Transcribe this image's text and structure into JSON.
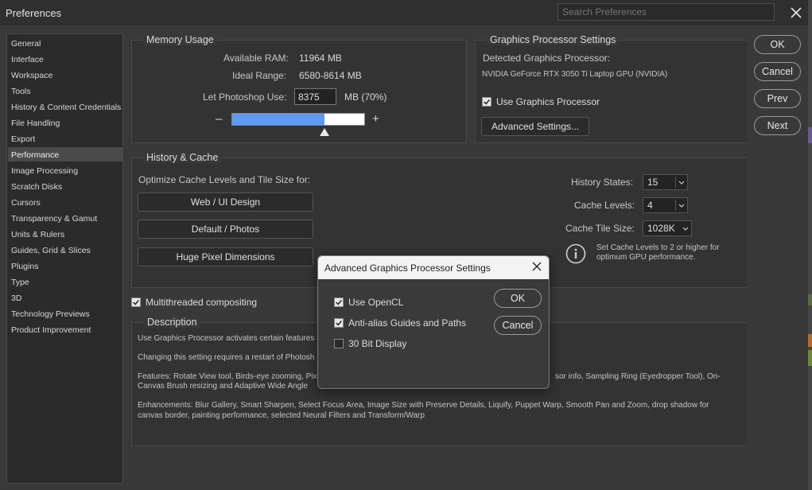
{
  "window": {
    "title": "Preferences",
    "search_placeholder": "Search Preferences"
  },
  "sidebar": {
    "items": [
      {
        "label": "General"
      },
      {
        "label": "Interface"
      },
      {
        "label": "Workspace"
      },
      {
        "label": "Tools"
      },
      {
        "label": "History & Content Credentials"
      },
      {
        "label": "File Handling"
      },
      {
        "label": "Export"
      },
      {
        "label": "Performance",
        "active": true
      },
      {
        "label": "Image Processing"
      },
      {
        "label": "Scratch Disks"
      },
      {
        "label": "Cursors"
      },
      {
        "label": "Transparency & Gamut"
      },
      {
        "label": "Units & Rulers"
      },
      {
        "label": "Guides, Grid & Slices"
      },
      {
        "label": "Plugins"
      },
      {
        "label": "Type"
      },
      {
        "label": "3D"
      },
      {
        "label": "Technology Previews"
      },
      {
        "label": "Product Improvement"
      }
    ]
  },
  "actions": {
    "ok": "OK",
    "cancel": "Cancel",
    "prev": "Prev",
    "next": "Next"
  },
  "memory": {
    "title": "Memory Usage",
    "available_label": "Available RAM:",
    "available_value": "11964 MB",
    "ideal_label": "Ideal Range:",
    "ideal_value": "6580-8614 MB",
    "use_label": "Let Photoshop Use:",
    "use_value": "8375",
    "use_unit": "MB (70%)",
    "minus": "–",
    "plus": "+",
    "slider_fraction": 0.7
  },
  "gpu": {
    "title": "Graphics Processor Settings",
    "detected_label": "Detected Graphics Processor:",
    "detected_value": "NVIDIA GeForce RTX 3050 Ti Laptop GPU (NVIDIA)",
    "use_gpu_label": "Use Graphics Processor",
    "use_gpu_checked": true,
    "advanced_button": "Advanced Settings..."
  },
  "history_cache": {
    "title": "History & Cache",
    "optimize_label": "Optimize Cache Levels and Tile Size for:",
    "buttons": [
      "Web / UI Design",
      "Default / Photos",
      "Huge Pixel Dimensions"
    ],
    "history_states_label": "History States:",
    "history_states_value": "15",
    "cache_levels_label": "Cache Levels:",
    "cache_levels_value": "4",
    "tile_size_label": "Cache Tile Size:",
    "tile_size_value": "1028K",
    "info_line1": "Set Cache Levels to 2 or higher for",
    "info_line2": "optimum GPU performance."
  },
  "multithreaded": {
    "label": "Multithreaded compositing",
    "checked": true
  },
  "description": {
    "title": "Description",
    "line1": "Use Graphics Processor activates certain features a",
    "line2": "Changing this setting requires a restart of Photosh",
    "line3a": "Features: Rotate View tool, Birds-eye zooming, Pixe",
    "line3b": "sor info, Sampling Ring (Eyedropper Tool), On-",
    "line4": "Canvas Brush resizing and Adaptive Wide Angle",
    "line5": "Enhancements: Blur Gallery, Smart Sharpen, Select Focus Area, Image Size with Preserve Details, Liquify, Puppet Warp, Smooth Pan and Zoom, drop shadow for",
    "line6": "canvas border, painting performance, selected Neural Filters and Transform/Warp"
  },
  "dialog": {
    "title": "Advanced Graphics Processor Settings",
    "options": [
      {
        "label": "Use OpenCL",
        "checked": true
      },
      {
        "label": "Anti-alias Guides and Paths",
        "checked": true
      },
      {
        "label": "30 Bit Display",
        "checked": false
      }
    ],
    "ok": "OK",
    "cancel": "Cancel"
  },
  "colors": {
    "accent": "#5f99f0",
    "background": "#393939",
    "panel": "#333333"
  }
}
